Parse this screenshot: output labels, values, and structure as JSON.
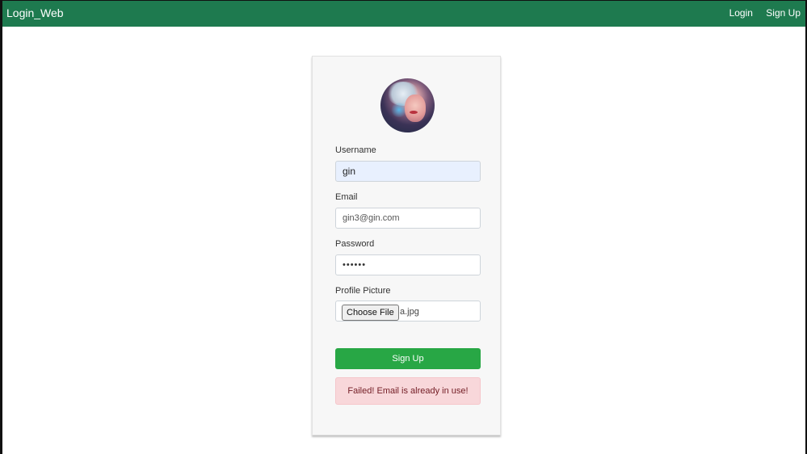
{
  "navbar": {
    "brand": "Login_Web",
    "links": [
      "Login",
      "Sign Up"
    ],
    "color": "#1e7a4f"
  },
  "form": {
    "avatar": "profile-picture",
    "fields": {
      "username": {
        "label": "Username",
        "value": "gin"
      },
      "email": {
        "label": "Email",
        "value": "gin3@gin.com"
      },
      "password": {
        "label": "Password",
        "value": "••••••"
      },
      "picture": {
        "label": "Profile Picture",
        "button": "Choose File",
        "filename": "a.jpg"
      }
    },
    "submit_label": "Sign Up",
    "submit_color": "#28a745",
    "alert": "Failed! Email is already in use!",
    "alert_color": "#f8d7da"
  }
}
